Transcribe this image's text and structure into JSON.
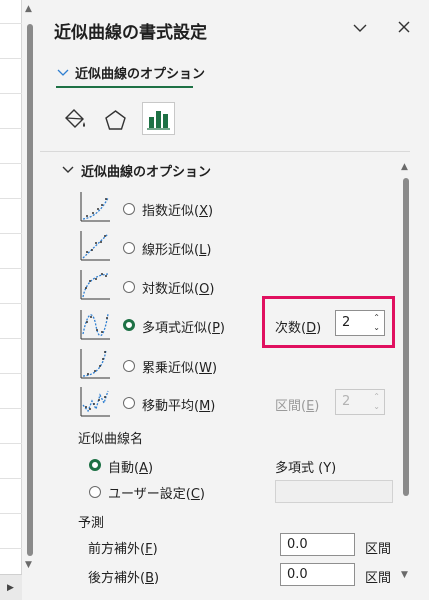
{
  "pane": {
    "title": "近似曲線の書式設定",
    "tab_label": "近似曲線のオプション",
    "section_title": "近似曲線のオプション"
  },
  "icons": {
    "fill": "paint-bucket-icon",
    "effects": "pentagon-icon",
    "options": "bar-chart-icon",
    "collapse": "chevron-down-icon",
    "close": "close-icon"
  },
  "trend_types": [
    {
      "label": "指数近似(",
      "key": "X",
      "tail": ")",
      "selected": false
    },
    {
      "label": "線形近似(",
      "key": "L",
      "tail": ")",
      "selected": false
    },
    {
      "label": "対数近似(",
      "key": "O",
      "tail": ")",
      "selected": false
    },
    {
      "label": "多項式近似(",
      "key": "P",
      "tail": ")",
      "selected": true
    },
    {
      "label": "累乗近似(",
      "key": "W",
      "tail": ")",
      "selected": false
    },
    {
      "label": "移動平均(",
      "key": "M",
      "tail": ")",
      "selected": false
    }
  ],
  "order": {
    "label": "次数(",
    "key": "D",
    "tail": ")",
    "value": "2"
  },
  "period": {
    "label": "区間(",
    "key": "E",
    "tail": ")",
    "value": "2"
  },
  "name_section": {
    "title": "近似曲線名",
    "auto_label": "自動(",
    "auto_key": "A",
    "auto_tail": ")",
    "custom_label": "ユーザー設定(",
    "custom_key": "C",
    "custom_tail": ")",
    "auto_value": "多項式 (Y)",
    "custom_value": ""
  },
  "forecast": {
    "title": "予測",
    "forward_label": "前方補外(",
    "forward_key": "F",
    "forward_tail": ")",
    "forward_value": "0.0",
    "backward_label": "後方補外(",
    "backward_key": "B",
    "backward_tail": ")",
    "backward_value": "0.0",
    "unit": "区間"
  },
  "colors": {
    "accent": "#1e7145",
    "highlight": "#e0105f",
    "trend_line": "#2f7fd1"
  }
}
